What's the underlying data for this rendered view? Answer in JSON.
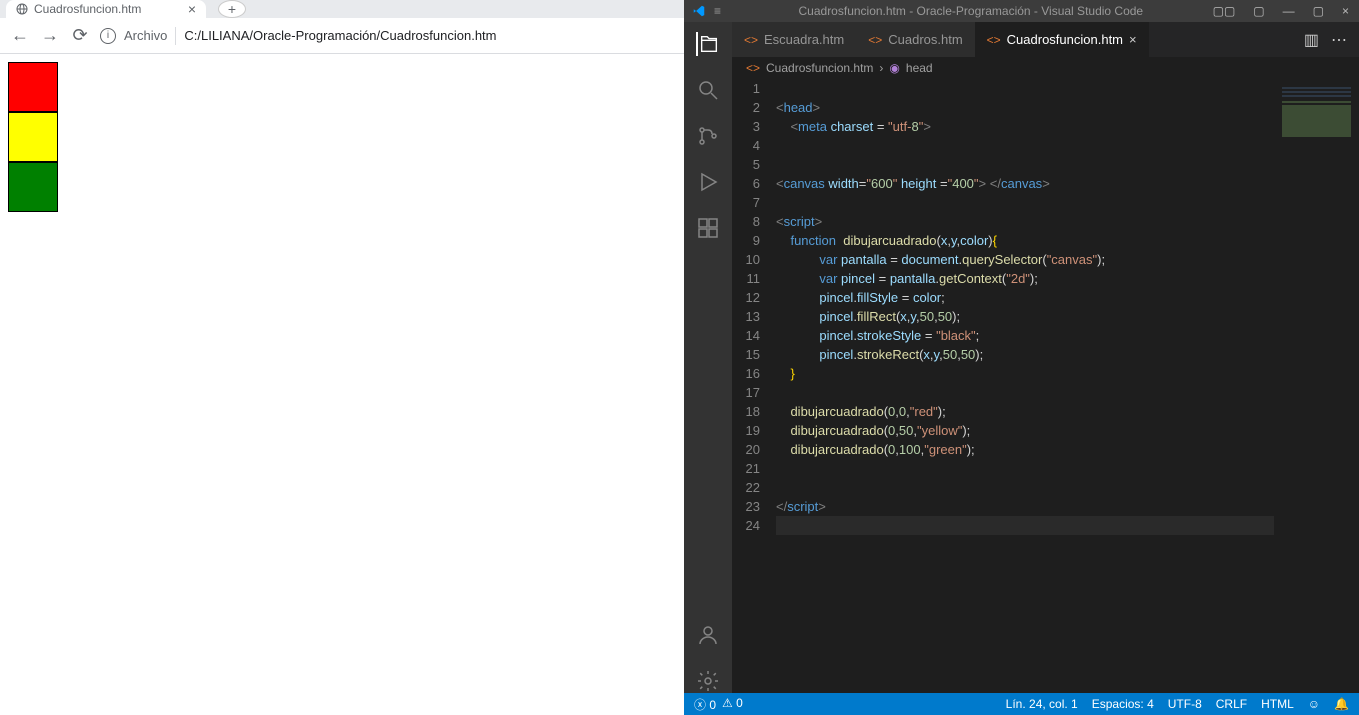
{
  "browser": {
    "tab_title": "Cuadrosfuncion.htm",
    "url_prefix": "Archivo",
    "url_path": "C:/LILIANA/Oracle-Programación/Cuadrosfuncion.htm",
    "squares": [
      {
        "color": "red"
      },
      {
        "color": "yellow"
      },
      {
        "color": "green"
      }
    ]
  },
  "vscode": {
    "title": "Cuadrosfuncion.htm - Oracle-Programación - Visual Studio Code",
    "tabs": [
      {
        "label": "Escuadra.htm",
        "active": false,
        "dirty": false
      },
      {
        "label": "Cuadros.htm",
        "active": false,
        "dirty": false
      },
      {
        "label": "Cuadrosfuncion.htm",
        "active": true,
        "dirty": false
      }
    ],
    "breadcrumb": {
      "file": "Cuadrosfuncion.htm",
      "symbol": "head"
    },
    "code_lines": [
      "",
      "<head>",
      "    <meta charset = \"utf-8\">",
      "",
      "",
      "<canvas width=\"600\" height =\"400\"> </canvas>",
      "",
      "<script>",
      "    function  dibujarcuadrado(x,y,color){",
      "            var pantalla = document.querySelector(\"canvas\");",
      "            var pincel = pantalla.getContext(\"2d\");",
      "            pincel.fillStyle = color;",
      "            pincel.fillRect(x,y,50,50);",
      "            pincel.strokeStyle = \"black\";",
      "            pincel.strokeRect(x,y,50,50);",
      "    }",
      "",
      "    dibujarcuadrado(0,0,\"red\");",
      "    dibujarcuadrado(0,50,\"yellow\");",
      "    dibujarcuadrado(0,100,\"green\");",
      "",
      "",
      "</script>",
      ""
    ],
    "status": {
      "errors": "0",
      "warnings": "0",
      "line_col": "Lín. 24, col. 1",
      "spaces": "Espacios: 4",
      "encoding": "UTF-8",
      "eol": "CRLF",
      "lang": "HTML"
    }
  }
}
